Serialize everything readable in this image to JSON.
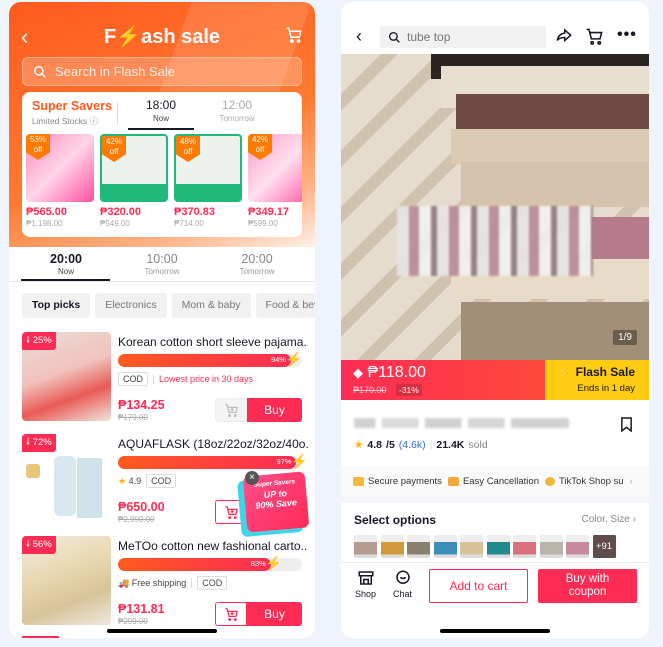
{
  "left": {
    "title_pre": "F",
    "title_bolt": "⚡",
    "title_post": "ash sale",
    "search_placeholder": "Search in Flash Sale",
    "super_savers": {
      "title": "Super Savers",
      "subtitle": "Limited Stocks ⓘ",
      "tabs": [
        {
          "time": "18:00",
          "label": "Now",
          "active": true
        },
        {
          "time": "12:00",
          "label": "Tomorrow",
          "active": false
        }
      ],
      "items": [
        {
          "discount": "53%",
          "off": "off",
          "price": "₱565.00",
          "old_price": "₱1,198.00"
        },
        {
          "discount": "42%",
          "off": "off",
          "price": "₱320.00",
          "old_price": "₱549.00"
        },
        {
          "discount": "48%",
          "off": "off",
          "price": "₱370.83",
          "old_price": "₱714.00"
        },
        {
          "discount": "42%",
          "off": "off",
          "price": "₱349.17",
          "old_price": "₱599.00"
        }
      ]
    },
    "time_tabs": [
      {
        "time": "20:00",
        "label": "Now",
        "active": true
      },
      {
        "time": "10:00",
        "label": "Tomorrow",
        "active": false
      },
      {
        "time": "20:00",
        "label": "Tomorrow",
        "active": false
      }
    ],
    "categories": [
      "Top picks",
      "Electronics",
      "Mom & baby",
      "Food & bev"
    ],
    "products": [
      {
        "badge": "🠗 25%",
        "name": "Korean cotton short sleeve pajama...",
        "progress_label": "94%",
        "progress": 0.94,
        "tags": [
          "COD"
        ],
        "highlight": "Lowest price in 30 days",
        "price": "₱134.25",
        "old_price": "₱179.00",
        "buy": "Buy"
      },
      {
        "badge": "🠗 72%",
        "name": "AQUAFLASK (18oz/22oz/32oz/40o...",
        "progress_label": "97%",
        "progress": 0.97,
        "rating": "4.9",
        "tags": [
          "COD"
        ],
        "price": "₱650.00",
        "old_price": "₱2,990.00",
        "buy": "Buy"
      },
      {
        "badge": "🠗 56%",
        "name": "MeTOo cotton new fashional carto...",
        "progress_label": "83%",
        "progress": 0.83,
        "shipping": "Free shipping",
        "tags": [
          "COD"
        ],
        "price": "₱131.81",
        "old_price": "₱299.00",
        "buy": "Buy"
      }
    ],
    "promo": {
      "line1": "Super Savers",
      "line2": "UP to",
      "line3": "90% Save",
      "close": "×"
    }
  },
  "right": {
    "search_value": "tube top",
    "image_counter": "1/9",
    "price": "₱118.00",
    "old_price": "₱170.00",
    "discount": "-31%",
    "flash_label": "Flash Sale",
    "flash_ends": "Ends in 1 day",
    "rating": "4.8",
    "rating_max": "/5",
    "rating_count": "(4.6k)",
    "sold_count": "21.4K",
    "sold_label": "sold",
    "guarantees": [
      "Secure payments",
      "Easy Cancellation",
      "TikTok Shop su"
    ],
    "options_title": "Select options",
    "options_link": "Color, Size",
    "more_options": "+91",
    "swatch_colors": [
      "#b89c92",
      "#d29a3a",
      "#8a7e6c",
      "#3d8fb8",
      "#d9c29a",
      "#1f8b8f",
      "#d8717d",
      "#b9b4ab",
      "#c58a9c"
    ],
    "footer": {
      "shop": "Shop",
      "chat": "Chat",
      "add_to_cart": "Add to cart",
      "buy_with_coupon_1": "Buy with",
      "buy_with_coupon_2": "coupon"
    }
  },
  "colors": {
    "accent": "#fe2c55",
    "flash_orange": "#ff5a1f",
    "flash_yellow": "#ffcc11"
  }
}
